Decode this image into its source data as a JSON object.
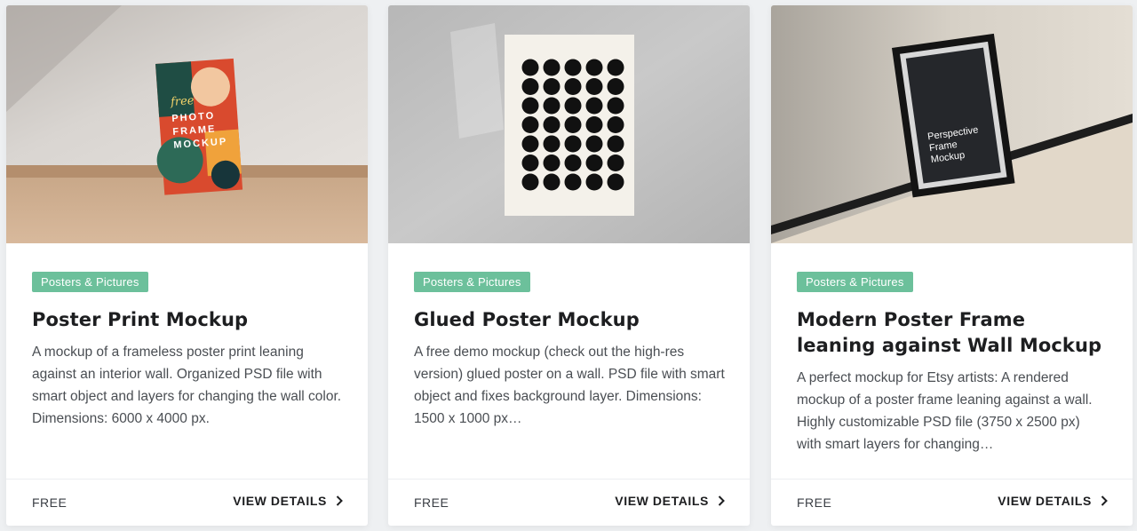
{
  "cards": [
    {
      "category": "Posters & Pictures",
      "title": "Poster Print Mockup",
      "description": "A mockup of a frameless poster print leaning against an interior wall. Organized PSD file with smart object and layers for changing the wall color. Dimensions: 6000 x 4000 px.",
      "price": "FREE",
      "cta": "VIEW DETAILS",
      "poster_text": {
        "script": "free",
        "line1": "PHOTO",
        "line2": "FRAME",
        "line3": "MOCKUP"
      }
    },
    {
      "category": "Posters & Pictures",
      "title": "Glued Poster Mockup",
      "description": "A free demo mockup (check out the high-res version) glued poster on a wall. PSD file with smart object and fixes background layer. Dimensions: 1500 x 1000 px…",
      "price": "FREE",
      "cta": "VIEW DETAILS"
    },
    {
      "category": "Posters & Pictures",
      "title": "Modern Poster Frame leaning against Wall Mockup",
      "description": "A perfect mockup for Etsy artists: A rendered mockup of a poster frame leaning against a wall. Highly customizable PSD file (3750 x 2500 px) with smart layers for changing…",
      "price": "FREE",
      "cta": "VIEW DETAILS",
      "poster_text": {
        "line1": "Perspective",
        "line2": "Frame",
        "line3": "Mockup"
      }
    }
  ],
  "colors": {
    "tag_bg": "#6cc09b",
    "page_bg": "#eef0f2"
  }
}
